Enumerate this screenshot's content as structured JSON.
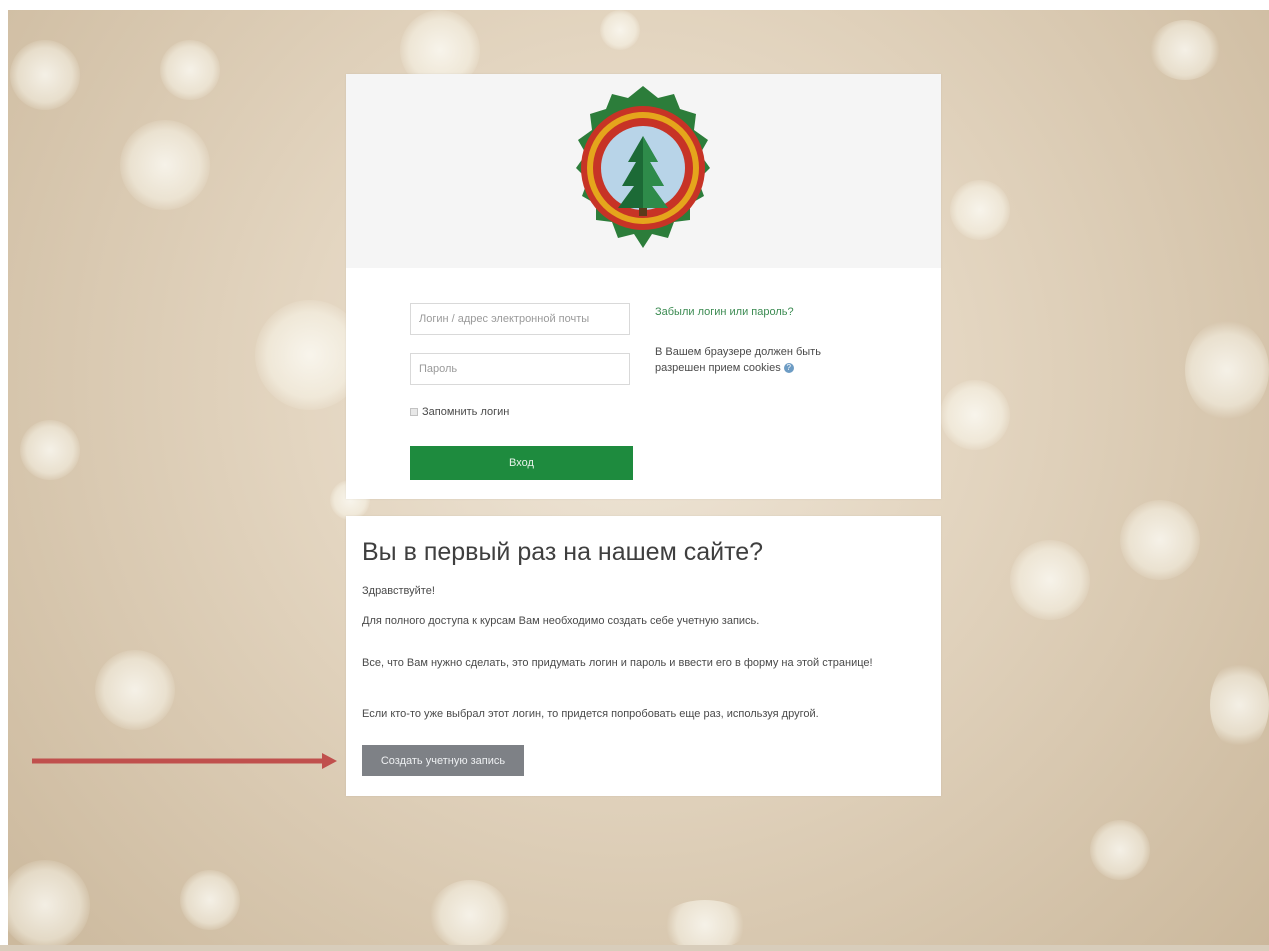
{
  "login": {
    "username_placeholder": "Логин / адрес электронной почты",
    "password_placeholder": "Пароль",
    "remember_label": "Запомнить логин",
    "submit_label": "Вход",
    "forgot_link": "Забыли логин или пароль?",
    "cookies_notice": "В Вашем браузере должен быть разрешен прием cookies"
  },
  "signup": {
    "heading": "Вы в первый раз на нашем сайте?",
    "greeting": "Здравствуйте!",
    "paragraphs": [
      "Для полного доступа к курсам Вам необходимо создать себе учетную запись.",
      "Все, что Вам нужно сделать, это придумать логин и пароль и ввести его в форму на этой странице!",
      "Если кто-то уже выбрал этот логин, то придется попробовать еще раз, используя другой."
    ],
    "button_label": "Создать учетную запись"
  },
  "colors": {
    "login_button": "#1e8b3e",
    "link": "#3c8b52",
    "signup_button": "#7e8186",
    "arrow": "#c0504d"
  },
  "icons": {
    "help": "help-icon",
    "logo": "fir-tree-emblem"
  }
}
